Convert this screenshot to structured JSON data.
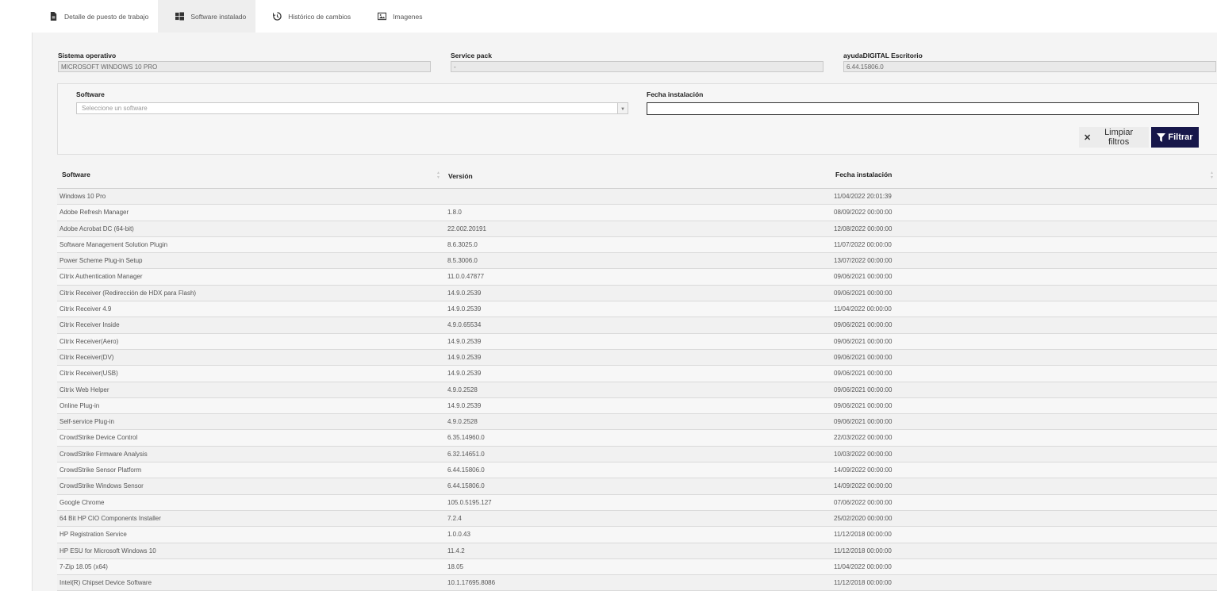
{
  "tabs": [
    {
      "label": "Detalle de puesto de trabajo",
      "icon": "document-icon",
      "active": false
    },
    {
      "label": "Software instalado",
      "icon": "windows-icon",
      "active": true
    },
    {
      "label": "Histórico de cambios",
      "icon": "history-icon",
      "active": false
    },
    {
      "label": "Imagenes",
      "icon": "image-icon",
      "active": false
    }
  ],
  "system": {
    "os_label": "Sistema operativo",
    "os_value": "MICROSOFT WINDOWS 10 PRO",
    "sp_label": "Service pack",
    "sp_value": "-",
    "ad_label": "ayudaDIGITAL Escritorio",
    "ad_value": "6.44.15806.0"
  },
  "filters": {
    "software_label": "Software",
    "software_placeholder": "Seleccione un software",
    "date_label": "Fecha instalación",
    "clear_label": "Limpiar filtros",
    "filter_label": "Filtrar"
  },
  "table": {
    "headers": [
      "Software",
      "Versión",
      "Fecha instalación"
    ],
    "rows": [
      [
        "Windows 10 Pro",
        "",
        "11/04/2022 20:01:39"
      ],
      [
        "Adobe Refresh Manager",
        "1.8.0",
        "08/09/2022 00:00:00"
      ],
      [
        "Adobe Acrobat DC (64-bit)",
        "22.002.20191",
        "12/08/2022 00:00:00"
      ],
      [
        "Software Management Solution Plugin",
        "8.6.3025.0",
        "11/07/2022 00:00:00"
      ],
      [
        "Power Scheme Plug-in Setup",
        "8.5.3006.0",
        "13/07/2022 00:00:00"
      ],
      [
        "Citrix Authentication Manager",
        "11.0.0.47877",
        "09/06/2021 00:00:00"
      ],
      [
        "Citrix Receiver (Redirección de HDX para Flash)",
        "14.9.0.2539",
        "09/06/2021 00:00:00"
      ],
      [
        "Citrix Receiver 4.9",
        "14.9.0.2539",
        "11/04/2022 00:00:00"
      ],
      [
        "Citrix Receiver Inside",
        "4.9.0.65534",
        "09/06/2021 00:00:00"
      ],
      [
        "Citrix Receiver(Aero)",
        "14.9.0.2539",
        "09/06/2021 00:00:00"
      ],
      [
        "Citrix Receiver(DV)",
        "14.9.0.2539",
        "09/06/2021 00:00:00"
      ],
      [
        "Citrix Receiver(USB)",
        "14.9.0.2539",
        "09/06/2021 00:00:00"
      ],
      [
        "Citrix Web Helper",
        "4.9.0.2528",
        "09/06/2021 00:00:00"
      ],
      [
        "Online Plug-in",
        "14.9.0.2539",
        "09/06/2021 00:00:00"
      ],
      [
        "Self-service Plug-in",
        "4.9.0.2528",
        "09/06/2021 00:00:00"
      ],
      [
        "CrowdStrike Device Control",
        "6.35.14960.0",
        "22/03/2022 00:00:00"
      ],
      [
        "CrowdStrike Firmware Analysis",
        "6.32.14651.0",
        "10/03/2022 00:00:00"
      ],
      [
        "CrowdStrike Sensor Platform",
        "6.44.15806.0",
        "14/09/2022 00:00:00"
      ],
      [
        "CrowdStrike Windows Sensor",
        "6.44.15806.0",
        "14/09/2022 00:00:00"
      ],
      [
        "Google Chrome",
        "105.0.5195.127",
        "07/06/2022 00:00:00"
      ],
      [
        "64 Bit HP CIO Components Installer",
        "7.2.4",
        "25/02/2020 00:00:00"
      ],
      [
        "HP Registration Service",
        "1.0.0.43",
        "11/12/2018 00:00:00"
      ],
      [
        "HP ESU for Microsoft Windows 10",
        "11.4.2",
        "11/12/2018 00:00:00"
      ],
      [
        "7-Zip 18.05 (x64)",
        "18.05",
        "11/04/2022 00:00:00"
      ],
      [
        "Intel(R) Chipset Device Software",
        "10.1.17695.8086",
        "11/12/2018 00:00:00"
      ]
    ]
  },
  "colors": {
    "accent": "#17174a",
    "panel": "#f4f4f4"
  }
}
